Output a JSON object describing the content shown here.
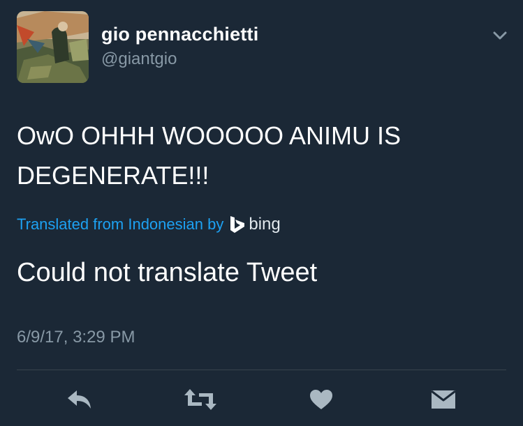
{
  "user": {
    "display_name": "gio pennacchietti",
    "handle": "@giantgio"
  },
  "tweet": {
    "text": "OwO OHHH WOOOOO ANIMU IS DEGENERATE!!!",
    "translation_label": "Translated from Indonesian by",
    "translation_provider": "bing",
    "translation_result": "Could not translate Tweet",
    "timestamp": "6/9/17, 3:29 PM"
  },
  "icons": {
    "menu": "chevron-down-icon",
    "reply": "reply-icon",
    "retweet": "retweet-icon",
    "like": "heart-icon",
    "dm": "envelope-icon",
    "provider": "bing-logo-icon"
  },
  "colors": {
    "background": "#1b2836",
    "link": "#1da1f2",
    "muted": "#8899a6",
    "action_icon": "#aab8c2"
  }
}
